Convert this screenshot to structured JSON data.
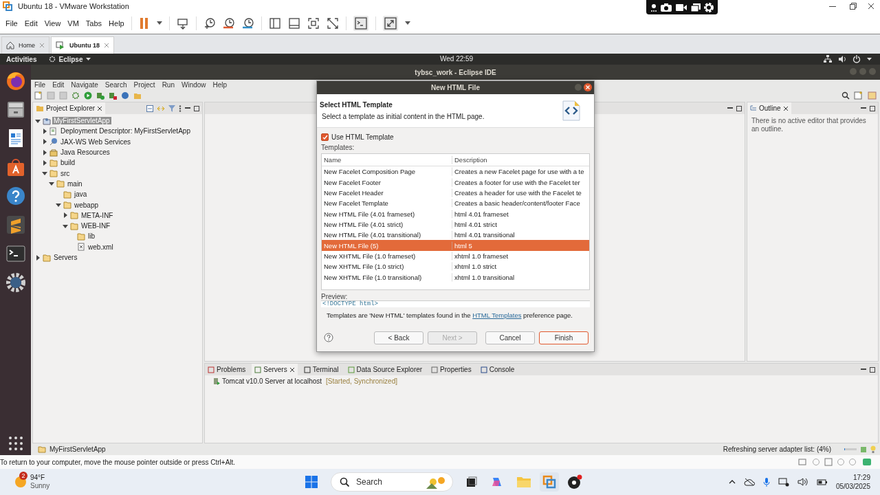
{
  "vmware": {
    "title": "Ubuntu 18 - VMware Workstation",
    "menu": [
      "File",
      "Edit",
      "View",
      "VM",
      "Tabs",
      "Help"
    ],
    "tabs": [
      {
        "label": "Home",
        "selected": false
      },
      {
        "label": "Ubuntu 18",
        "selected": true
      }
    ],
    "hint": "To return to your computer, move the mouse pointer outside or press Ctrl+Alt."
  },
  "ubuntu": {
    "activities": "Activities",
    "app": "Eclipse",
    "clock": "Wed 22:59"
  },
  "eclipse": {
    "title": "tybsc_work - Eclipse IDE",
    "menu": [
      "File",
      "Edit",
      "Navigate",
      "Search",
      "Project",
      "Run",
      "Window",
      "Help"
    ],
    "project_explorer": {
      "title": "Project Explorer",
      "tree": [
        {
          "label": "MyFirstServletApp",
          "kind": "project",
          "expanded": true,
          "selected": true,
          "children": [
            {
              "label": "Deployment Descriptor: MyFirstServletApp",
              "kind": "descriptor",
              "expanded": false,
              "selected": false
            },
            {
              "label": "JAX-WS Web Services",
              "kind": "webservices",
              "expanded": false,
              "selected": false
            },
            {
              "label": "Java Resources",
              "kind": "resources",
              "expanded": false,
              "selected": false
            },
            {
              "label": "build",
              "kind": "folder",
              "expanded": false,
              "selected": false
            },
            {
              "label": "src",
              "kind": "folder",
              "expanded": true,
              "selected": false,
              "children": [
                {
                  "label": "main",
                  "kind": "folder",
                  "expanded": true,
                  "selected": false,
                  "children": [
                    {
                      "label": "java",
                      "kind": "folder",
                      "selected": false
                    },
                    {
                      "label": "webapp",
                      "kind": "folder",
                      "expanded": true,
                      "selected": false,
                      "children": [
                        {
                          "label": "META-INF",
                          "kind": "folder",
                          "expanded": false,
                          "selected": false
                        },
                        {
                          "label": "WEB-INF",
                          "kind": "folder",
                          "expanded": true,
                          "selected": false,
                          "children": [
                            {
                              "label": "lib",
                              "kind": "folder",
                              "selected": false
                            },
                            {
                              "label": "web.xml",
                              "kind": "file",
                              "selected": false
                            }
                          ]
                        }
                      ]
                    }
                  ]
                }
              ]
            }
          ]
        },
        {
          "label": "Servers",
          "kind": "folder",
          "expanded": false,
          "selected": false
        }
      ]
    },
    "outline": {
      "title": "Outline",
      "message": "There is no active editor that provides an outline."
    },
    "bottom_panel": {
      "tabs": [
        {
          "label": "Problems",
          "selected": false
        },
        {
          "label": "Servers",
          "selected": true
        },
        {
          "label": "Terminal",
          "selected": false
        },
        {
          "label": "Data Source Explorer",
          "selected": false
        },
        {
          "label": "Properties",
          "selected": false
        },
        {
          "label": "Console",
          "selected": false
        }
      ],
      "servers": [
        {
          "name": "Tomcat v10.0 Server at localhost",
          "state": "[Started, Synchronized]"
        }
      ]
    },
    "status_bar": {
      "selection": "MyFirstServletApp",
      "progress_text": "Refreshing server adapter list: (4%)",
      "level": 0.04
    }
  },
  "dialog": {
    "title": "New HTML File",
    "heading": "Select HTML Template",
    "description": "Select a template as initial content in the HTML page.",
    "use_template": {
      "label": "Use HTML Template",
      "checked": true
    },
    "templates_label": "Templates:",
    "columns": [
      "Name",
      "Description"
    ],
    "rows": [
      {
        "name": "New Facelet Composition Page",
        "description": "Creates a new Facelet page for use with a te",
        "selected": false
      },
      {
        "name": "New Facelet Footer",
        "description": "Creates a footer for use with the Facelet ter",
        "selected": false
      },
      {
        "name": "New Facelet Header",
        "description": "Creates a header for use with the Facelet te",
        "selected": false
      },
      {
        "name": "New Facelet Template",
        "description": "Creates a basic header/content/footer Face",
        "selected": false
      },
      {
        "name": "New HTML File (4.01 frameset)",
        "description": "html 4.01 frameset",
        "selected": false
      },
      {
        "name": "New HTML File (4.01 strict)",
        "description": "html 4.01 strict",
        "selected": false
      },
      {
        "name": "New HTML File (4.01 transitional)",
        "description": "html 4.01 transitional",
        "selected": false
      },
      {
        "name": "New HTML File (5)",
        "description": "html 5",
        "selected": true
      },
      {
        "name": "New XHTML File (1.0 frameset)",
        "description": "xhtml 1.0 frameset",
        "selected": false
      },
      {
        "name": "New XHTML File (1.0 strict)",
        "description": "xhtml 1.0 strict",
        "selected": false
      },
      {
        "name": "New XHTML File (1.0 transitional)",
        "description": "xhtml 1.0 transitional",
        "selected": false
      }
    ],
    "preview_label": "Preview:",
    "preview": "<!DOCTYPE html>",
    "note": {
      "before": "Templates are 'New HTML' templates found in the ",
      "link": "HTML Templates",
      "after": " preference page."
    },
    "buttons": [
      {
        "label": "< Back",
        "disabled": false
      },
      {
        "label": "Next >",
        "disabled": true
      },
      {
        "label": "Cancel",
        "disabled": false
      },
      {
        "label": "Finish",
        "disabled": false
      }
    ]
  },
  "taskbar": {
    "weather": {
      "badge": "2",
      "temp": "94°F",
      "condition": "Sunny"
    },
    "search": {
      "placeholder": "Search"
    },
    "time": "17:29",
    "date": "05/03/2025"
  }
}
